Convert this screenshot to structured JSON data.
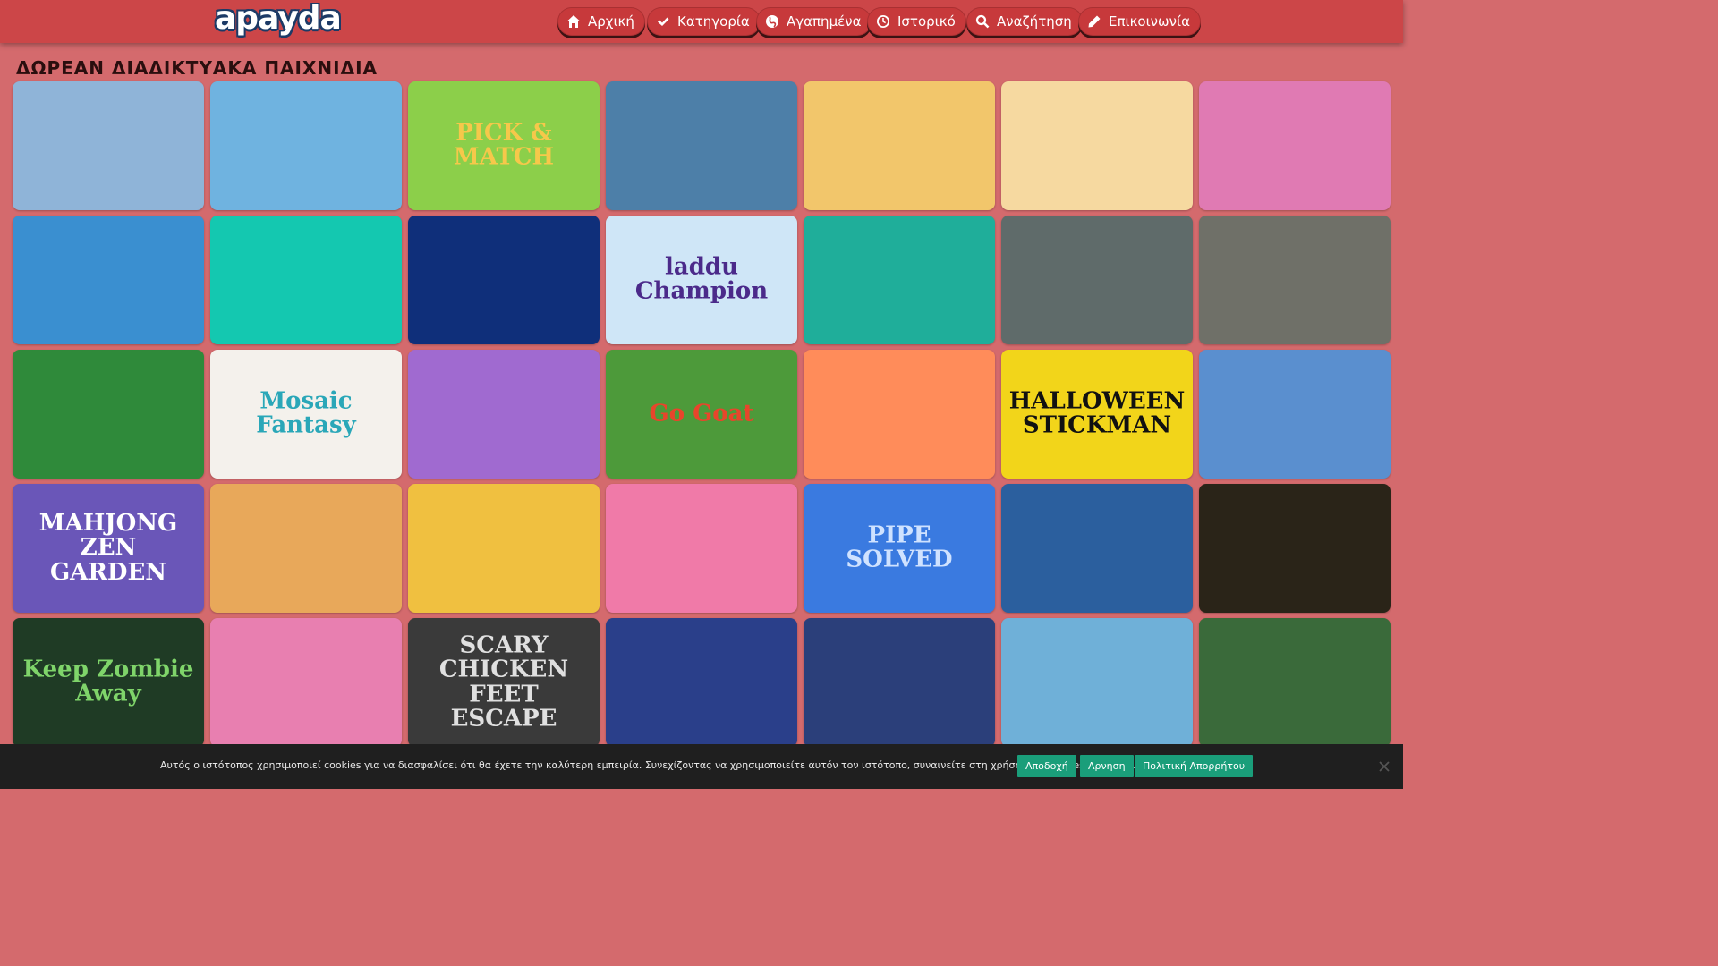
{
  "header": {
    "logo": "apayda",
    "nav": [
      {
        "label": "Αρχική",
        "icon": "home-icon"
      },
      {
        "label": "Κατηγορία",
        "icon": "check-icon"
      },
      {
        "label": "Αγαπημένα",
        "icon": "globe-icon"
      },
      {
        "label": "Ιστορικό",
        "icon": "clock-icon"
      },
      {
        "label": "Αναζήτηση",
        "icon": "search-icon"
      },
      {
        "label": "Επικοινωνία",
        "icon": "pencil-icon"
      }
    ]
  },
  "main": {
    "title": "ΔΩΡΕΑΝ ΔΙΑΔΙΚΤΥΑΚΑ ΠΑΙΧΝΙΔΙΑ",
    "tiles": [
      {
        "caption": "",
        "bg": "#8fb4d8"
      },
      {
        "caption": "",
        "bg": "#6fb3e0"
      },
      {
        "caption": "PICK & MATCH",
        "bg": "#8ccf4a",
        "color": "#f6c84a"
      },
      {
        "caption": "",
        "bg": "#4d7fa8"
      },
      {
        "caption": "",
        "bg": "#f2c66b"
      },
      {
        "caption": "",
        "bg": "#f6d9a0"
      },
      {
        "caption": "",
        "bg": "#e07ab3"
      },
      {
        "caption": "",
        "bg": "#3a8fd0"
      },
      {
        "caption": "",
        "bg": "#14c8b0"
      },
      {
        "caption": "",
        "bg": "#0f2f7a"
      },
      {
        "caption": "laddu Champion",
        "bg": "#cfe6f7",
        "color": "#4b2a8a"
      },
      {
        "caption": "",
        "bg": "#1fae9a"
      },
      {
        "caption": "",
        "bg": "#5f6b6a"
      },
      {
        "caption": "",
        "bg": "#6f7068"
      },
      {
        "caption": "",
        "bg": "#2f8a3a"
      },
      {
        "caption": "Mosaic Fantasy",
        "bg": "#f4f1ec",
        "color": "#2aa7b8"
      },
      {
        "caption": "",
        "bg": "#a06ad0"
      },
      {
        "caption": "Go Goat",
        "bg": "#4d9a3a",
        "color": "#e8452b"
      },
      {
        "caption": "",
        "bg": "#ff8c5a"
      },
      {
        "caption": "HALLOWEEN STICKMAN",
        "bg": "#f2d51a",
        "color": "#111111"
      },
      {
        "caption": "",
        "bg": "#5a8fcf"
      },
      {
        "caption": "MAHJONG ZEN GARDEN",
        "bg": "#6a56b8",
        "color": "#ffffff"
      },
      {
        "caption": "",
        "bg": "#e8a85a"
      },
      {
        "caption": "",
        "bg": "#f0c040"
      },
      {
        "caption": "",
        "bg": "#f07aa8"
      },
      {
        "caption": "PIPE SOLVED",
        "bg": "#3a7ae0",
        "color": "#cfe2ff"
      },
      {
        "caption": "",
        "bg": "#2b5f9e"
      },
      {
        "caption": "",
        "bg": "#2a2418"
      },
      {
        "caption": "Keep Zombie Away",
        "bg": "#1f3b25",
        "color": "#7fd46a"
      },
      {
        "caption": "",
        "bg": "#e87fb0"
      },
      {
        "caption": "SCARY CHICKEN FEET ESCAPE",
        "bg": "#3a3a3a",
        "color": "#e0e0e0"
      },
      {
        "caption": "",
        "bg": "#2a3f8a"
      },
      {
        "caption": "",
        "bg": "#2b3f7a"
      },
      {
        "caption": "",
        "bg": "#6fb0d8"
      },
      {
        "caption": "",
        "bg": "#3a6a3a"
      }
    ]
  },
  "cookie": {
    "text": "Αυτός ο ιστότοπος χρησιμοποιεί cookies για να διασφαλίσει ότι θα έχετε την καλύτερη εμπειρία. Συνεχίζοντας να χρησιμοποιείτε αυτόν τον ιστότοπο, συναινείτε στη χρήση των cookies από εμάς.",
    "accept": "Αποδοχή",
    "reject": "Αρνηση",
    "policy": "Πολιτική Απορρήτου"
  }
}
